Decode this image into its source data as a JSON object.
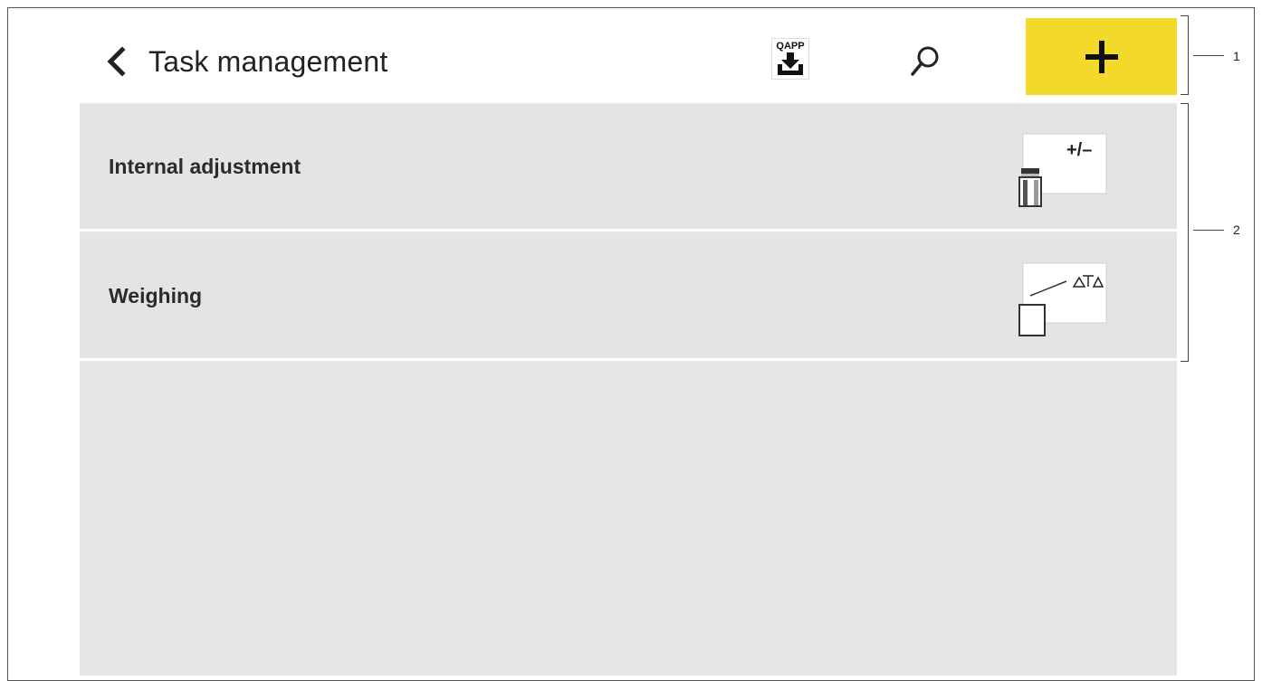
{
  "header": {
    "back_icon": "chevron-left-icon",
    "title": "Task management",
    "qapp_label": "QAPP",
    "qapp_icon": "qapp-import-icon",
    "search_icon": "search-icon",
    "add_icon": "plus-icon",
    "add_color": "#f3da2a"
  },
  "tasks": [
    {
      "label": "Internal adjustment",
      "icon": "internal-adjustment-icon",
      "icon_text": "+/–"
    },
    {
      "label": "Weighing",
      "icon": "weighing-icon"
    }
  ],
  "callouts": [
    "1",
    "2"
  ]
}
